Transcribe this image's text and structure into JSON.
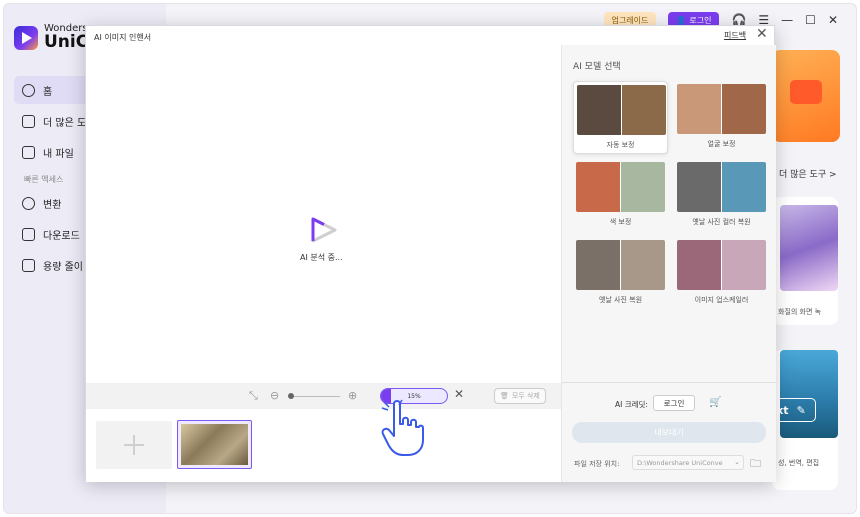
{
  "app": {
    "brand_line1": "Wonders",
    "brand_line2": "UniCo",
    "upgrade_label": "업그레이드",
    "login_label": "로그인",
    "nav": [
      {
        "label": "홈",
        "icon": "home-icon"
      },
      {
        "label": "더 많은 도",
        "icon": "toolbox-icon"
      },
      {
        "label": "내 파일",
        "icon": "file-icon"
      }
    ],
    "section_label": "빠른 액세스",
    "quick": [
      {
        "label": "변환",
        "icon": "convert-icon"
      },
      {
        "label": "다운로드",
        "icon": "download-icon"
      },
      {
        "label": "용량 줄이",
        "icon": "compress-icon"
      }
    ],
    "more_tools": "더 많은 도구 >",
    "card2_text": "화질의 화면 녹",
    "card3_pill": "xt",
    "card3_text": "성, 번역, 편집"
  },
  "dialog": {
    "title": "AI 이미지 인핸서",
    "feedback": "피드백",
    "status": "AI 분석 중...",
    "progress_percent": 15,
    "progress_text": "15%",
    "delete_all": "모두 삭제",
    "panel_title": "AI 모델 선택",
    "models": [
      {
        "label": "자동 보정",
        "selected": true,
        "left": "#5a4a40",
        "right": "#8a6a48"
      },
      {
        "label": "얼굴 보정",
        "selected": false,
        "left": "#c89878",
        "right": "#a06848"
      },
      {
        "label": "색 보정",
        "selected": false,
        "left": "#c86a4a",
        "right": "#a8b8a0"
      },
      {
        "label": "옛날 사진 컬러 복원",
        "selected": false,
        "left": "#6a6a6a",
        "right": "#5a98b8"
      },
      {
        "label": "옛날 사진 복원",
        "selected": false,
        "left": "#7a7068",
        "right": "#a8988a"
      },
      {
        "label": "이미지 업스케일러",
        "selected": false,
        "left": "#9a6878",
        "right": "#c8a8b8"
      }
    ],
    "credit_label": "AI 크레딧:",
    "credit_login": "로그인",
    "export_label": "내보내기",
    "save_label": "파일 저장 위치:",
    "save_path": "D:\\Wondershare UniConve"
  }
}
